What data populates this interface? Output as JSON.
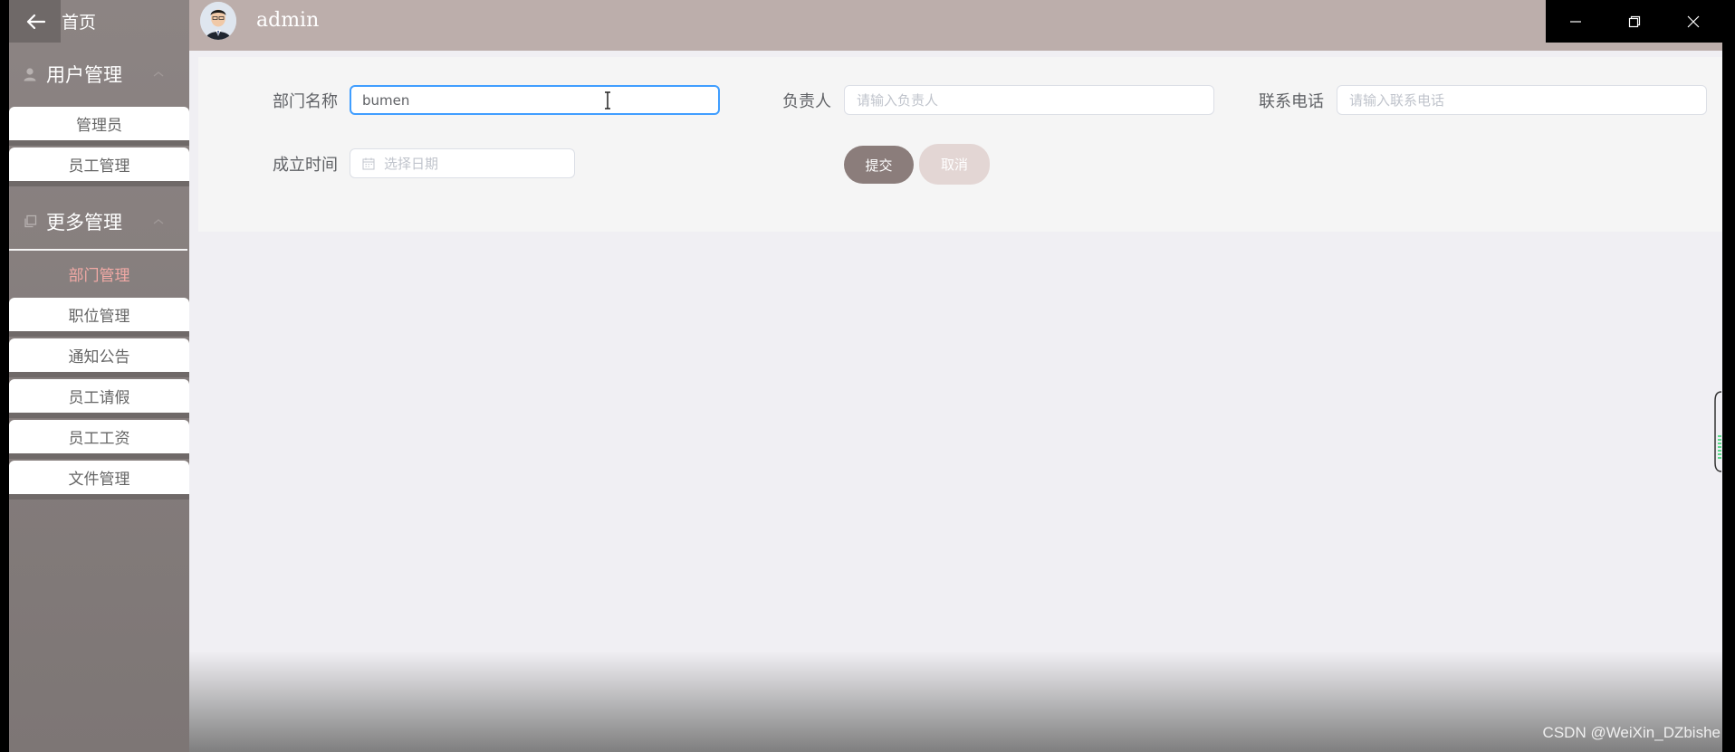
{
  "sidebar": {
    "home_label": "首页",
    "groups": [
      {
        "title": "用户管理",
        "icon": "user-icon"
      },
      {
        "title": "更多管理",
        "icon": "copy-icon"
      }
    ],
    "user_items": [
      "管理员",
      "员工管理"
    ],
    "more_items": [
      "部门管理",
      "职位管理",
      "通知公告",
      "员工请假",
      "员工工资",
      "文件管理"
    ],
    "active_item": "部门管理"
  },
  "header": {
    "username": "admin"
  },
  "form": {
    "dept_name_label": "部门名称",
    "dept_name_value": "bumen",
    "manager_label": "负责人",
    "manager_placeholder": "请输入负责人",
    "phone_label": "联系电话",
    "phone_placeholder": "请输入联系电话",
    "founded_label": "成立时间",
    "founded_placeholder": "选择日期",
    "submit_label": "提交",
    "cancel_label": "取消"
  },
  "watermark": "CSDN @WeiXin_DZbishe",
  "colors": {
    "sidebar": "#847c7b",
    "header": "#bcaeab",
    "active_menu_text": "#f1a9a5",
    "submit_button": "#8b7d7b",
    "cancel_button": "#e3d6d4",
    "focus_border": "#409eff"
  }
}
